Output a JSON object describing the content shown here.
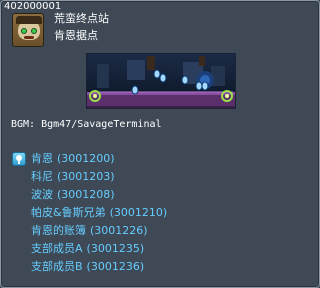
{
  "map": {
    "id": "402000001",
    "region": "荒蛮终点站",
    "name": "肯恩据点",
    "icon": "station-mascot-icon",
    "bgm": "BGM: Bgm47/SavageTerminal"
  },
  "npcs": [
    {
      "name": "肯恩",
      "id": "(3001200)",
      "icon": "npc-quest-icon"
    },
    {
      "name": "科尼",
      "id": "(3001203)"
    },
    {
      "name": "波波",
      "id": "(3001208)"
    },
    {
      "name": "帕皮&鲁斯兄弟",
      "id": "(3001210)"
    },
    {
      "name": "肯恩的账簿",
      "id": "(3001226)"
    },
    {
      "name": "支部成员A",
      "id": "(3001235)"
    },
    {
      "name": "支部成员B",
      "id": "(3001236)"
    }
  ],
  "colors": {
    "background": "#3e4955",
    "npc_text": "#66ccff",
    "text": "#ffffff"
  }
}
